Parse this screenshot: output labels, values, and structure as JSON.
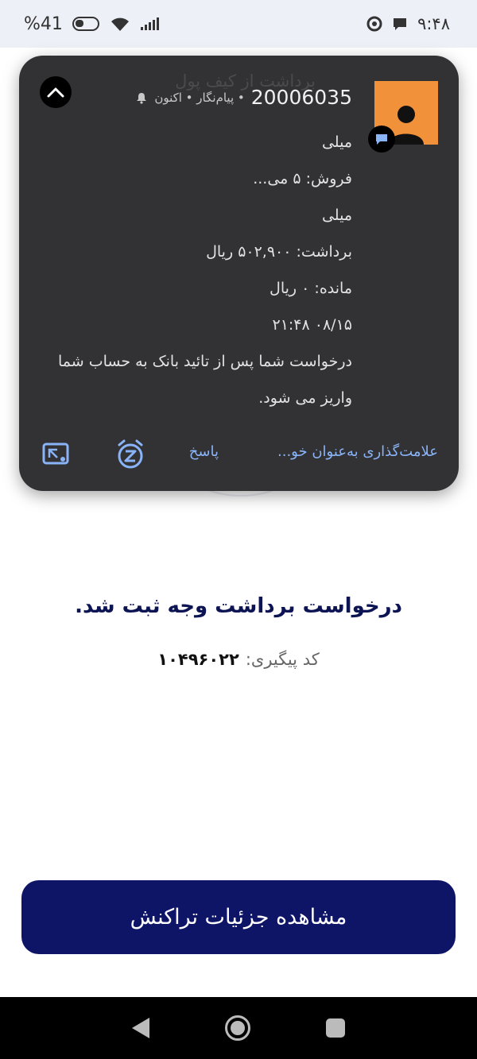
{
  "status_bar": {
    "time": "۹:۴۸",
    "battery": "%41"
  },
  "notification": {
    "ghost_title": "برداشت از کیف پول",
    "sender": "20006035",
    "meta": "• پیام‌نگار • اکنون",
    "lines": [
      "میلی",
      "فروش: ۵ می...",
      "میلی",
      "برداشت: ۵۰۲,۹۰۰ ریال",
      "مانده: ۰ ریال",
      "۰۸/۱۵ ۲۱:۴۸"
    ],
    "message": "درخواست شما پس از تائید بانک به حساب شما واریز می شود.",
    "actions": {
      "mark_as": "علامت‌گذاری به‌عنوان خو...",
      "reply": "پاسخ"
    },
    "colors": {
      "card": "#2b2b2e",
      "avatar": "#f1923b",
      "action": "#8ab4f8"
    }
  },
  "page": {
    "success_title": "درخواست برداشت وجه ثبت شد.",
    "tracking_label": "کد پیگیری:",
    "tracking_code": "۱۰۴۹۶۰۲۲",
    "details_button": "مشاهده جزئیات تراکنش",
    "colors": {
      "primary": "#0e1566",
      "title": "#0d1453"
    }
  },
  "icons": [
    "battery-icon",
    "wifi-icon",
    "signal-icon",
    "chrome-icon",
    "chat-bubble-icon",
    "chevron-up-icon",
    "person-icon",
    "message-badge-icon",
    "bell-icon",
    "snooze-icon",
    "picture-in-picture-icon",
    "back-icon",
    "home-icon",
    "recents-icon"
  ]
}
